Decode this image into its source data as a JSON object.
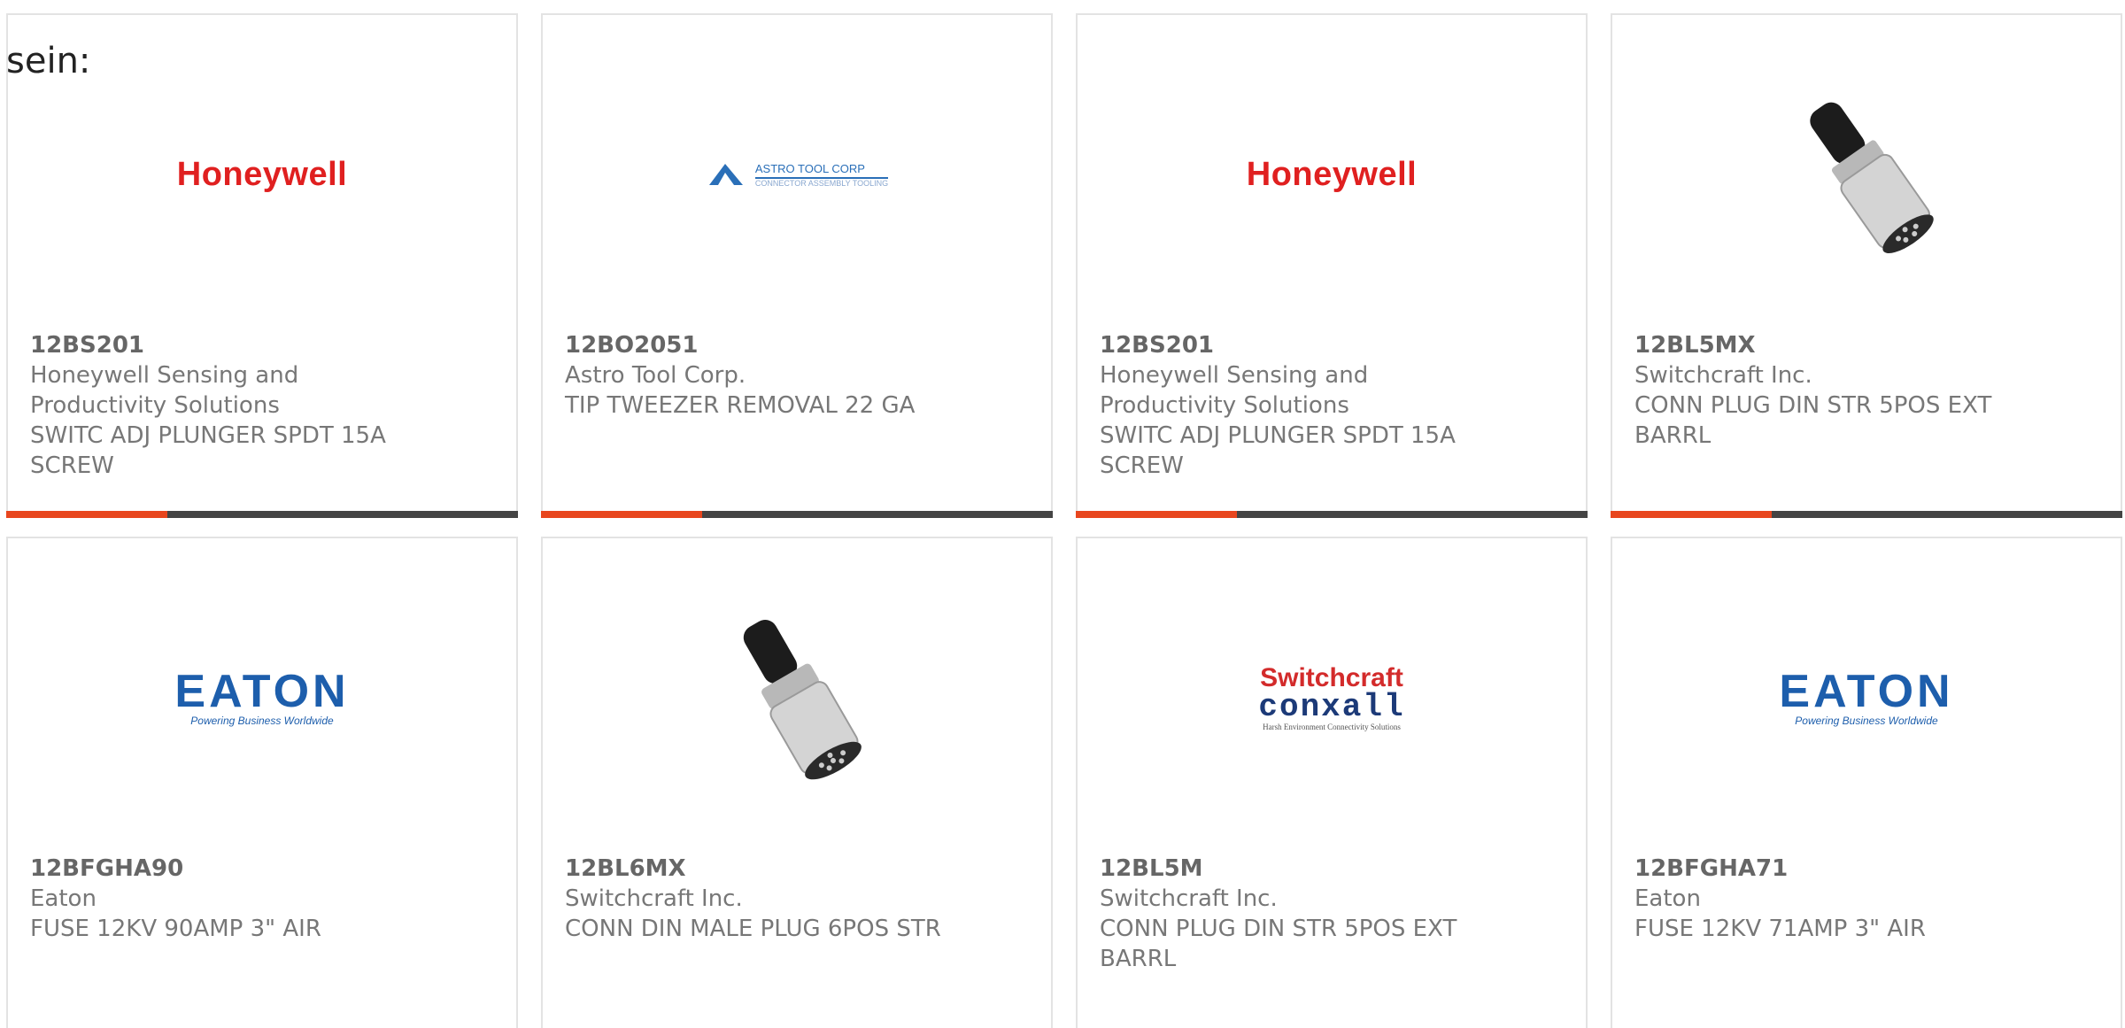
{
  "intro": "sein:",
  "colors": {
    "accent": "#e8461e",
    "bar": "#444444",
    "border": "#e3e3e3"
  },
  "cards": [
    {
      "part": "12BS201",
      "manufacturer": "Honeywell Sensing and Productivity Solutions",
      "description": "SWITC ADJ PLUNGER SPDT 15A SCREW",
      "image": "honeywell-logo",
      "logo_text": "Honeywell"
    },
    {
      "part": "12BO2051",
      "manufacturer": "Astro Tool Corp.",
      "description": "TIP TWEEZER REMOVAL 22 GA",
      "image": "astro-tool-corp-logo",
      "logo_text": "ASTRO TOOL CORP",
      "logo_sub": "CONNECTOR ASSEMBLY TOOLING"
    },
    {
      "part": "12BS201",
      "manufacturer": "Honeywell Sensing and Productivity Solutions",
      "description": "SWITC ADJ PLUNGER SPDT 15A SCREW",
      "image": "honeywell-logo",
      "logo_text": "Honeywell"
    },
    {
      "part": "12BL5MX",
      "manufacturer": "Switchcraft Inc.",
      "description": "CONN PLUG DIN STR 5POS EXT BARRL",
      "image": "din-plug-photo"
    },
    {
      "part": "12BFGHA90",
      "manufacturer": "Eaton",
      "description": "FUSE 12KV 90AMP 3\" AIR",
      "image": "eaton-logo",
      "logo_text": "EATON",
      "logo_sub": "Powering Business Worldwide"
    },
    {
      "part": "12BL6MX",
      "manufacturer": "Switchcraft Inc.",
      "description": "CONN DIN MALE PLUG 6POS STR",
      "image": "din-plug-photo"
    },
    {
      "part": "12BL5M",
      "manufacturer": "Switchcraft Inc.",
      "description": "CONN PLUG DIN STR 5POS EXT BARRL",
      "image": "switchcraft-conxall-logo",
      "logo_text": "Switchcraft",
      "logo_text2": "conxall",
      "logo_sub": "Harsh Environment Connectivity Solutions"
    },
    {
      "part": "12BFGHA71",
      "manufacturer": "Eaton",
      "description": "FUSE 12KV 71AMP 3\" AIR",
      "image": "eaton-logo",
      "logo_text": "EATON",
      "logo_sub": "Powering Business Worldwide"
    }
  ]
}
